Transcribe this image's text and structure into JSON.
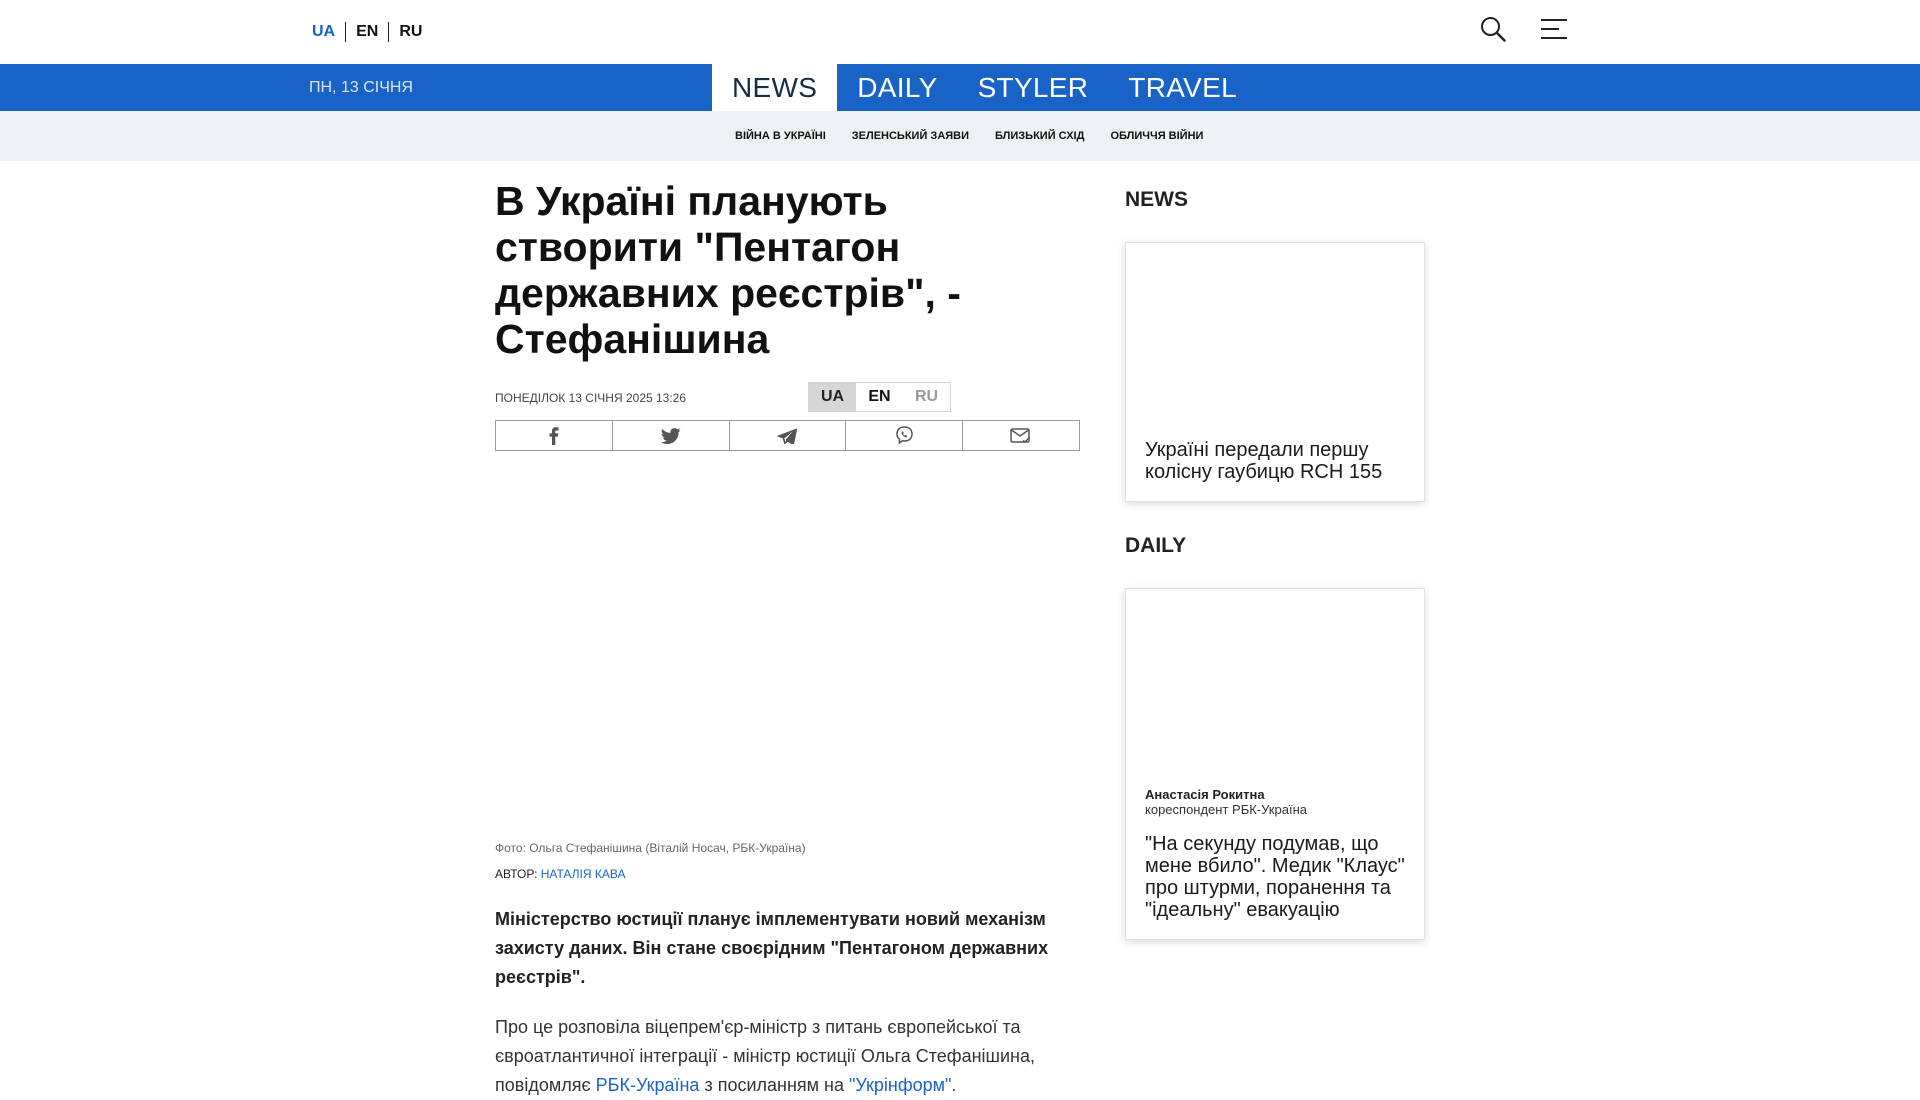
{
  "header": {
    "languages": [
      {
        "label": "UA",
        "active": true
      },
      {
        "label": "EN",
        "active": false
      },
      {
        "label": "RU",
        "active": false
      }
    ],
    "icons": [
      "search-icon",
      "menu-icon"
    ]
  },
  "nav": {
    "date": "ПН, 13 СІЧНЯ",
    "sections": [
      "NEWS",
      "DAILY",
      "STYLER",
      "TRAVEL"
    ],
    "active_section": "NEWS"
  },
  "subnav": {
    "tags": [
      "ВІЙНА В УКРАЇНІ",
      "ЗЕЛЕНСЬКИЙ ЗАЯВИ",
      "БЛИЗЬКИЙ СХІД",
      "ОБЛИЧЧЯ ВІЙНИ"
    ]
  },
  "article": {
    "title": "В Україні планують створити \"Пентагон державних реєстрів\", - Стефанішина",
    "date": "ПОНЕДІЛОК 13 СІЧНЯ 2025 13:26",
    "languages": [
      "UA",
      "EN",
      "RU"
    ],
    "share_icons": [
      "facebook-icon",
      "twitter-icon",
      "telegram-icon",
      "viber-icon",
      "email-icon"
    ],
    "photo_caption": "Фото: Ольга Стефанішина (Віталій Носач, РБК-Україна)",
    "author_label": "АВТОР:",
    "author_name": "НАТАЛІЯ КАВА",
    "lead": "Міністерство юстиції планує імплементувати новий механізм захисту даних. Він стане своєрідним \"Пентагоном державних реєстрів\".",
    "body": {
      "part1": "Про це розповіла віцепрем'єр-міністр з питань європейської та євроатлантичної інтеграції - міністр юстиції Ольга Стефанішина, повідомляє ",
      "link1": "РБК-Україна",
      "part2": " з посиланням на ",
      "link2": "\"Укрінформ\"",
      "part3": "."
    }
  },
  "sidebar": {
    "news_title": "NEWS",
    "news_card": "Україні передали першу колісну гаубицю RCH 155",
    "daily_title": "DAILY",
    "daily_card": {
      "author": "Анастасія Рокитна",
      "role": "кореспондент РБК-Україна",
      "text": "\"На секунду подумав, що мене вбило\". Медик \"Клаус\" про штурми, поранення та \"ідеальну\" евакуацію"
    }
  },
  "colors": {
    "brand_blue": "#1a63c6",
    "subnav_bg": "#eef0f3"
  }
}
